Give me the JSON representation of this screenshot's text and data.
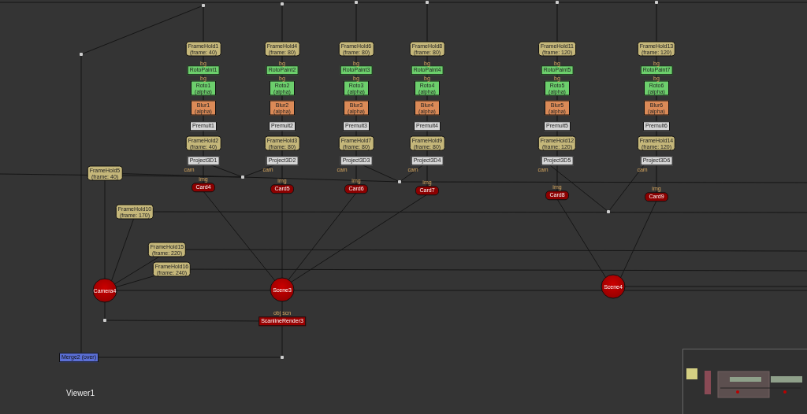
{
  "columns": [
    {
      "nodes": [
        {
          "kind": "framehold",
          "name": "FrameHold1",
          "sub": "(frame: 40)"
        },
        {
          "kind": "paint",
          "name": "RotoPaint1",
          "input": "bg"
        },
        {
          "kind": "roto",
          "name": "Roto1",
          "sub": "(alpha)",
          "input": "bg"
        },
        {
          "kind": "blur",
          "name": "Blur1",
          "sub": "(alpha)"
        },
        {
          "kind": "premult",
          "name": "Premult1"
        },
        {
          "kind": "framehold",
          "name": "FrameHold2",
          "sub": "(frame: 40)"
        },
        {
          "kind": "project",
          "name": "Project3D1",
          "input": "cam"
        },
        {
          "kind": "card",
          "name": "Card4",
          "input": "img"
        }
      ]
    },
    {
      "nodes": [
        {
          "kind": "framehold",
          "name": "FrameHold4",
          "sub": "(frame: 80)"
        },
        {
          "kind": "paint",
          "name": "RotoPaint2",
          "input": "bg"
        },
        {
          "kind": "roto",
          "name": "Roto2",
          "sub": "(alpha)",
          "input": "bg"
        },
        {
          "kind": "blur",
          "name": "Blur2",
          "sub": "(alpha)"
        },
        {
          "kind": "premult",
          "name": "Premult2"
        },
        {
          "kind": "framehold",
          "name": "FrameHold3",
          "sub": "(frame: 80)"
        },
        {
          "kind": "project",
          "name": "Project3D2",
          "input": "cam"
        },
        {
          "kind": "card",
          "name": "Card5",
          "input": "img"
        }
      ]
    },
    {
      "nodes": [
        {
          "kind": "framehold",
          "name": "FrameHold6",
          "sub": "(frame: 80)"
        },
        {
          "kind": "paint",
          "name": "RotoPaint3",
          "input": "bg"
        },
        {
          "kind": "roto",
          "name": "Roto3",
          "sub": "(alpha)",
          "input": "bg"
        },
        {
          "kind": "blur",
          "name": "Blur3",
          "sub": "(alpha)"
        },
        {
          "kind": "premult",
          "name": "Premult3"
        },
        {
          "kind": "framehold",
          "name": "FrameHold7",
          "sub": "(frame: 80)"
        },
        {
          "kind": "project",
          "name": "Project3D3",
          "input": "cam"
        },
        {
          "kind": "card",
          "name": "Card6",
          "input": "img"
        }
      ]
    },
    {
      "nodes": [
        {
          "kind": "framehold",
          "name": "FrameHold8",
          "sub": "(frame: 80)"
        },
        {
          "kind": "paint",
          "name": "RotoPaint4",
          "input": "bg"
        },
        {
          "kind": "roto",
          "name": "Roto4",
          "sub": "(alpha)",
          "input": "bg"
        },
        {
          "kind": "blur",
          "name": "Blur4",
          "sub": "(alpha)"
        },
        {
          "kind": "premult",
          "name": "Premult4"
        },
        {
          "kind": "framehold",
          "name": "FrameHold9",
          "sub": "(frame: 80)"
        },
        {
          "kind": "project",
          "name": "Project3D4",
          "input": "cam"
        },
        {
          "kind": "card",
          "name": "Card7",
          "input": "img"
        }
      ]
    },
    {
      "nodes": [
        {
          "kind": "framehold",
          "name": "FrameHold11",
          "sub": "(frame: 120)"
        },
        {
          "kind": "paint",
          "name": "RotoPaint5",
          "input": "bg"
        },
        {
          "kind": "roto",
          "name": "Roto5",
          "sub": "(alpha)",
          "input": "bg"
        },
        {
          "kind": "blur",
          "name": "Blur5",
          "sub": "(alpha)"
        },
        {
          "kind": "premult",
          "name": "Premult5"
        },
        {
          "kind": "framehold",
          "name": "FrameHold12",
          "sub": "(frame: 120)"
        },
        {
          "kind": "project",
          "name": "Project3D5",
          "input": "cam"
        },
        {
          "kind": "card",
          "name": "Card8",
          "input": "img"
        }
      ]
    },
    {
      "nodes": [
        {
          "kind": "framehold",
          "name": "FrameHold13",
          "sub": "(frame: 120)"
        },
        {
          "kind": "paint",
          "name": "RotoPaint7",
          "input": "bg"
        },
        {
          "kind": "roto",
          "name": "Roto6",
          "sub": "(alpha)",
          "input": "bg"
        },
        {
          "kind": "blur",
          "name": "Blur6",
          "sub": "(alpha)"
        },
        {
          "kind": "premult",
          "name": "Premult6"
        },
        {
          "kind": "framehold",
          "name": "FrameHold14",
          "sub": "(frame: 120)"
        },
        {
          "kind": "project",
          "name": "Project3D6",
          "input": "cam"
        },
        {
          "kind": "card",
          "name": "Card9",
          "input": "img"
        }
      ]
    }
  ],
  "side_nodes": [
    {
      "kind": "framehold",
      "name": "FrameHold5",
      "sub": "(frame: 40)"
    },
    {
      "kind": "framehold",
      "name": "FrameHold10",
      "sub": "(frame: 170)"
    },
    {
      "kind": "framehold",
      "name": "FrameHold15",
      "sub": "(frame: 220)"
    },
    {
      "kind": "framehold",
      "name": "FrameHold16",
      "sub": "(frame: 240)"
    },
    {
      "kind": "camera",
      "name": "Camera4"
    },
    {
      "kind": "scene",
      "name": "Scene3"
    },
    {
      "kind": "scene",
      "name": "Scene4"
    },
    {
      "kind": "render",
      "name": "ScanlineRender3",
      "input": "obj scn"
    },
    {
      "kind": "merge",
      "name": "Merge2 (over)"
    }
  ],
  "viewer": {
    "label": "Viewer1"
  }
}
